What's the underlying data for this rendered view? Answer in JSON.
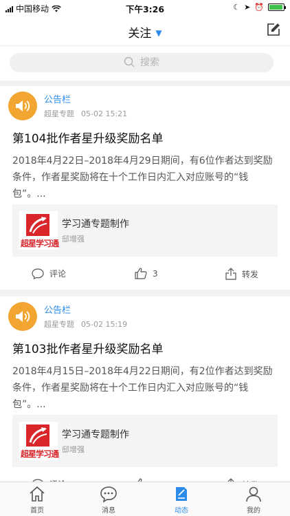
{
  "status_bar": {
    "carrier": "中国移动",
    "time": "下午3:26",
    "battery_level": 0.95
  },
  "nav": {
    "title": "关注",
    "chevron_icon": "chevron-down-icon",
    "edit_icon": "edit-icon"
  },
  "search": {
    "placeholder": "搜索"
  },
  "posts": [
    {
      "author": "公告栏",
      "source": "超星专题",
      "time": "05-02 15:21",
      "title": "第104批作者星升级奖励名单",
      "body": "2018年4月22日–2018年4月29日期间，有6位作者达到奖励条件，作者星奖励将在十个工作日内汇入对应账号的“钱包”。...",
      "link": {
        "title": "学习通专题制作",
        "author": "邸增强",
        "logo_text": "超星学习通"
      },
      "actions": {
        "comment": "评论",
        "likes": "3",
        "share": "转发"
      }
    },
    {
      "author": "公告栏",
      "source": "超星专题",
      "time": "05-02 15:19",
      "title": "第103批作者星升级奖励名单",
      "body": "2018年4月15日–2018年4月22日期间，有2位作者达到奖励条件，作者星奖励将在十个工作日内汇入对应账号的“钱包”。...",
      "link": {
        "title": "学习通专题制作",
        "author": "邸增强",
        "logo_text": "超星学习通"
      },
      "actions": {
        "comment": "评论",
        "likes": "",
        "share": "转发"
      }
    }
  ],
  "tabs": [
    {
      "label": "首页",
      "icon": "home-icon"
    },
    {
      "label": "消息",
      "icon": "message-icon"
    },
    {
      "label": "动态",
      "icon": "feed-icon",
      "active": true
    },
    {
      "label": "我的",
      "icon": "profile-icon"
    }
  ],
  "colors": {
    "accent": "#2b8be8",
    "avatar": "#f3a531",
    "logo_red": "#d8262b"
  }
}
